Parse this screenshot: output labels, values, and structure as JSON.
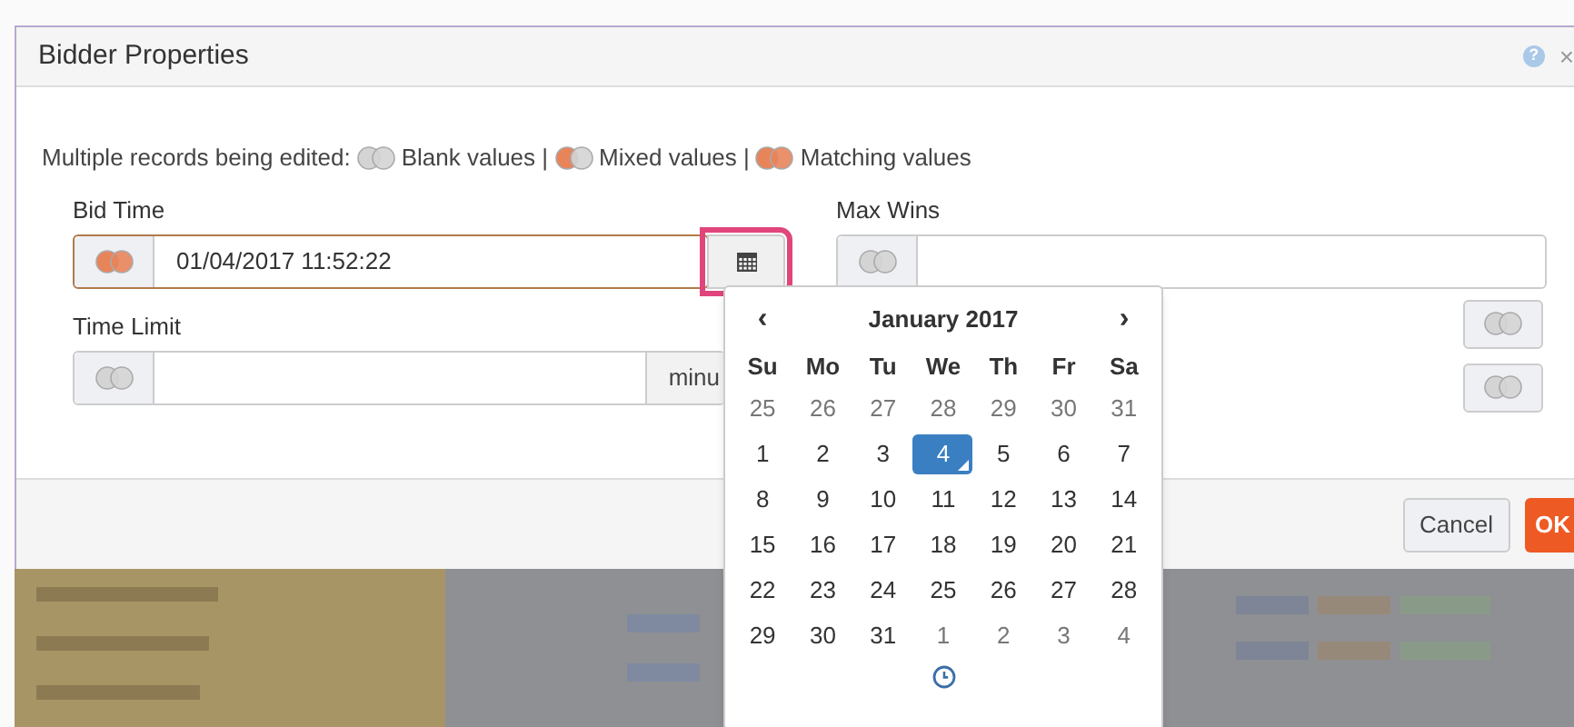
{
  "dialog": {
    "title": "Bidder Properties",
    "help_icon": "?",
    "close_icon": "×"
  },
  "legend": {
    "label": "Multiple records being edited:",
    "items": [
      {
        "kind": "blank",
        "text": "Blank values |"
      },
      {
        "kind": "mixed",
        "text": "Mixed values |"
      },
      {
        "kind": "matching",
        "text": "Matching values"
      }
    ]
  },
  "fields": [
    {
      "label": "Bid Time",
      "kind": "matching",
      "value": "01/04/2017 11:52:22",
      "focused": true
    },
    {
      "label": "Max Wins",
      "kind": "blank",
      "focused": false
    },
    {
      "label": "Time Limit",
      "kind": "blank",
      "addon": "minu",
      "focused": false
    }
  ],
  "side_buttons": [
    {
      "kind": "blank"
    },
    {
      "kind": "blank"
    }
  ],
  "buttons": [
    "Cancel",
    "OK"
  ],
  "datepicker": {
    "prev": "‹",
    "next": "›",
    "month": "January 2017",
    "weekdays": [
      "Su",
      "Mo",
      "Tu",
      "We",
      "Th",
      "Fr",
      "Sa"
    ],
    "days": [
      [
        {
          "d": "25",
          "muted": true,
          "selected": false
        },
        {
          "d": "26",
          "muted": true,
          "selected": false
        },
        {
          "d": "27",
          "muted": true,
          "selected": false
        },
        {
          "d": "28",
          "muted": true,
          "selected": false
        },
        {
          "d": "29",
          "muted": true,
          "selected": false
        },
        {
          "d": "30",
          "muted": true,
          "selected": false
        },
        {
          "d": "31",
          "muted": true,
          "selected": false
        }
      ],
      [
        {
          "d": "1",
          "muted": false,
          "selected": false
        },
        {
          "d": "2",
          "muted": false,
          "selected": false
        },
        {
          "d": "3",
          "muted": false,
          "selected": false
        },
        {
          "d": "4",
          "muted": false,
          "selected": true
        },
        {
          "d": "5",
          "muted": false,
          "selected": false
        },
        {
          "d": "6",
          "muted": false,
          "selected": false
        },
        {
          "d": "7",
          "muted": false,
          "selected": false
        }
      ],
      [
        {
          "d": "8",
          "muted": false,
          "selected": false
        },
        {
          "d": "9",
          "muted": false,
          "selected": false
        },
        {
          "d": "10",
          "muted": false,
          "selected": false
        },
        {
          "d": "11",
          "muted": false,
          "selected": false
        },
        {
          "d": "12",
          "muted": false,
          "selected": false
        },
        {
          "d": "13",
          "muted": false,
          "selected": false
        },
        {
          "d": "14",
          "muted": false,
          "selected": false
        }
      ],
      [
        {
          "d": "15",
          "muted": false,
          "selected": false
        },
        {
          "d": "16",
          "muted": false,
          "selected": false
        },
        {
          "d": "17",
          "muted": false,
          "selected": false
        },
        {
          "d": "18",
          "muted": false,
          "selected": false
        },
        {
          "d": "19",
          "muted": false,
          "selected": false
        },
        {
          "d": "20",
          "muted": false,
          "selected": false
        },
        {
          "d": "21",
          "muted": false,
          "selected": false
        }
      ],
      [
        {
          "d": "22",
          "muted": false,
          "selected": false
        },
        {
          "d": "23",
          "muted": false,
          "selected": false
        },
        {
          "d": "24",
          "muted": false,
          "selected": false
        },
        {
          "d": "25",
          "muted": false,
          "selected": false
        },
        {
          "d": "26",
          "muted": false,
          "selected": false
        },
        {
          "d": "27",
          "muted": false,
          "selected": false
        },
        {
          "d": "28",
          "muted": false,
          "selected": false
        }
      ],
      [
        {
          "d": "29",
          "muted": false,
          "selected": false
        },
        {
          "d": "30",
          "muted": false,
          "selected": false
        },
        {
          "d": "31",
          "muted": false,
          "selected": false
        },
        {
          "d": "1",
          "muted": true,
          "selected": false
        },
        {
          "d": "2",
          "muted": true,
          "selected": false
        },
        {
          "d": "3",
          "muted": true,
          "selected": false
        },
        {
          "d": "4",
          "muted": true,
          "selected": false
        }
      ]
    ]
  }
}
